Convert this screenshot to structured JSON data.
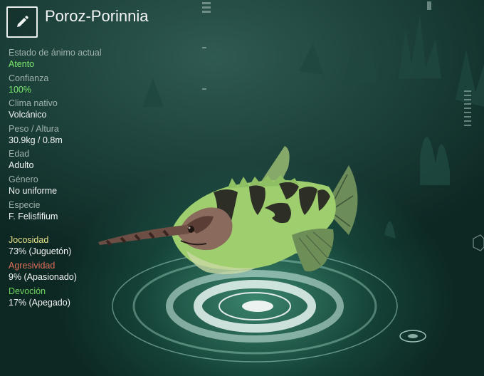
{
  "creature": {
    "name": "Poroz-Porinnia"
  },
  "stats": [
    {
      "label": "Estado de ánimo actual",
      "value": "Atento",
      "highlight": true
    },
    {
      "label": "Confianza",
      "value": "100%",
      "highlight": true
    },
    {
      "label": "Clima nativo",
      "value": "Volcánico",
      "highlight": false
    },
    {
      "label": "Peso / Altura",
      "value": "30.9kg / 0.8m",
      "highlight": false
    },
    {
      "label": "Edad",
      "value": "Adulto",
      "highlight": false
    },
    {
      "label": "Género",
      "value": "No uniforme",
      "highlight": false
    },
    {
      "label": "Especie",
      "value": "F. Felisfifium",
      "highlight": false
    }
  ],
  "traits": [
    {
      "label": "Jocosidad",
      "value": "73% (Juguetón)",
      "color": "#e9e38a"
    },
    {
      "label": "Agresividad",
      "value": "9% (Apasionado)",
      "color": "#e0705c"
    },
    {
      "label": "Devoción",
      "value": "17% (Apegado)",
      "color": "#6fd45c"
    }
  ],
  "icons": {
    "edit": "pencil-icon"
  }
}
